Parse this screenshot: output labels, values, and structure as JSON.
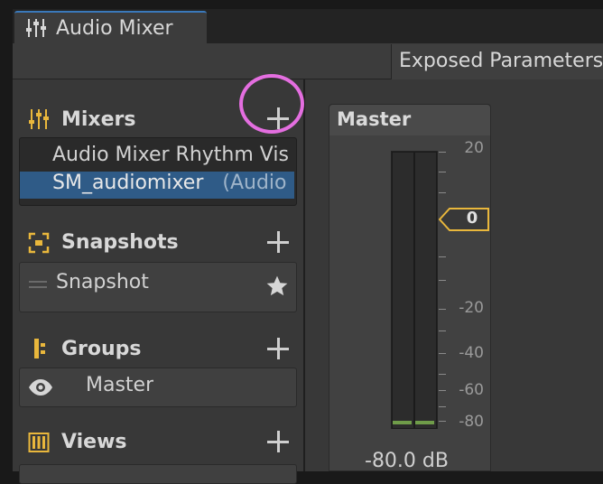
{
  "window": {
    "tab_title": "Audio Mixer"
  },
  "toolbar": {
    "exposed_parameters_label": "Exposed Parameters"
  },
  "sections": {
    "mixers": {
      "title": "Mixers",
      "items": [
        "Audio Mixer Rhythm Vis",
        "SM_audiomixer"
      ],
      "selected_suffix": "(Audio"
    },
    "snapshots": {
      "title": "Snapshots",
      "items": [
        "Snapshot"
      ]
    },
    "groups": {
      "title": "Groups",
      "items": [
        "Master"
      ]
    },
    "views": {
      "title": "Views"
    }
  },
  "strip": {
    "title": "Master",
    "scale_labels": [
      "20",
      "0",
      "-20",
      "-40",
      "-60",
      "-80"
    ],
    "gain_value": "0",
    "db_readout": "-80.0 dB"
  },
  "colors": {
    "accent_blue": "#3a79bb",
    "selection": "#2f5b87",
    "icon_yellow": "#e9b73c",
    "highlight_circle": "#e46ee0",
    "meter_green": "#6f9c49"
  },
  "icons": [
    "mixer-sliders-icon",
    "add-icon",
    "snapshot-icon",
    "star-icon",
    "group-icon",
    "eye-icon",
    "views-icon"
  ]
}
